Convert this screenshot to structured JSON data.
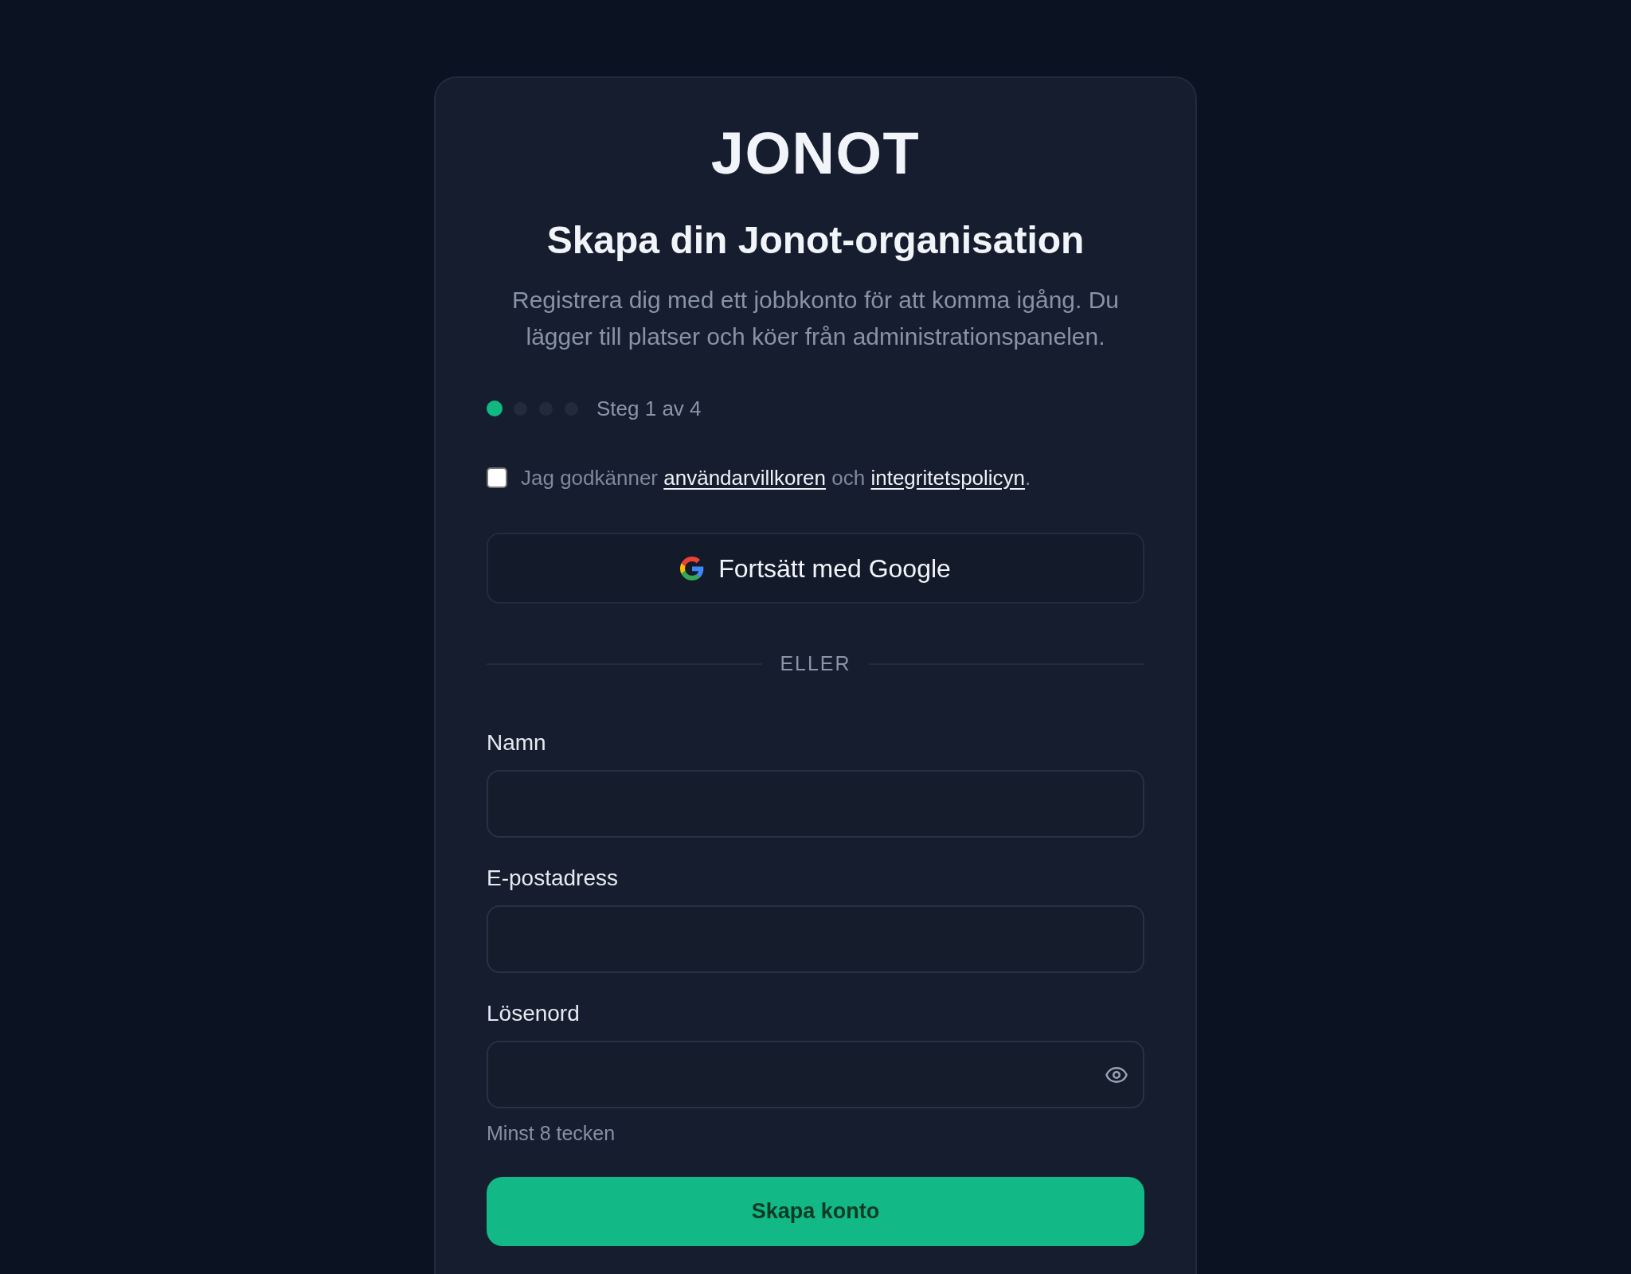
{
  "logo": "JONOT",
  "title": "Skapa din Jonot-organisation",
  "subtitle": "Registrera dig med ett jobbkonto för att komma igång. Du lägger till platser och köer från administrationspanelen.",
  "progress": {
    "steps": [
      {
        "active": true
      },
      {
        "active": false
      },
      {
        "active": false
      },
      {
        "active": false
      }
    ],
    "label": "Steg 1 av 4"
  },
  "consent": {
    "checked": false,
    "parts": [
      {
        "kind": "text",
        "text": "Jag godkänner "
      },
      {
        "kind": "link",
        "text": "användarvillkoren"
      },
      {
        "kind": "text",
        "text": " och "
      },
      {
        "kind": "link",
        "text": "integritetspolicyn"
      },
      {
        "kind": "text",
        "text": "."
      }
    ]
  },
  "google_button": {
    "label": "Fortsätt med Google"
  },
  "divider": "ELLER",
  "fields": [
    {
      "kind": "text",
      "label": "Namn"
    },
    {
      "kind": "email",
      "label": "E-postadress"
    },
    {
      "kind": "password",
      "label": "Lösenord",
      "hint": "Minst 8 tecken"
    }
  ],
  "submit_button": "Skapa konto"
}
